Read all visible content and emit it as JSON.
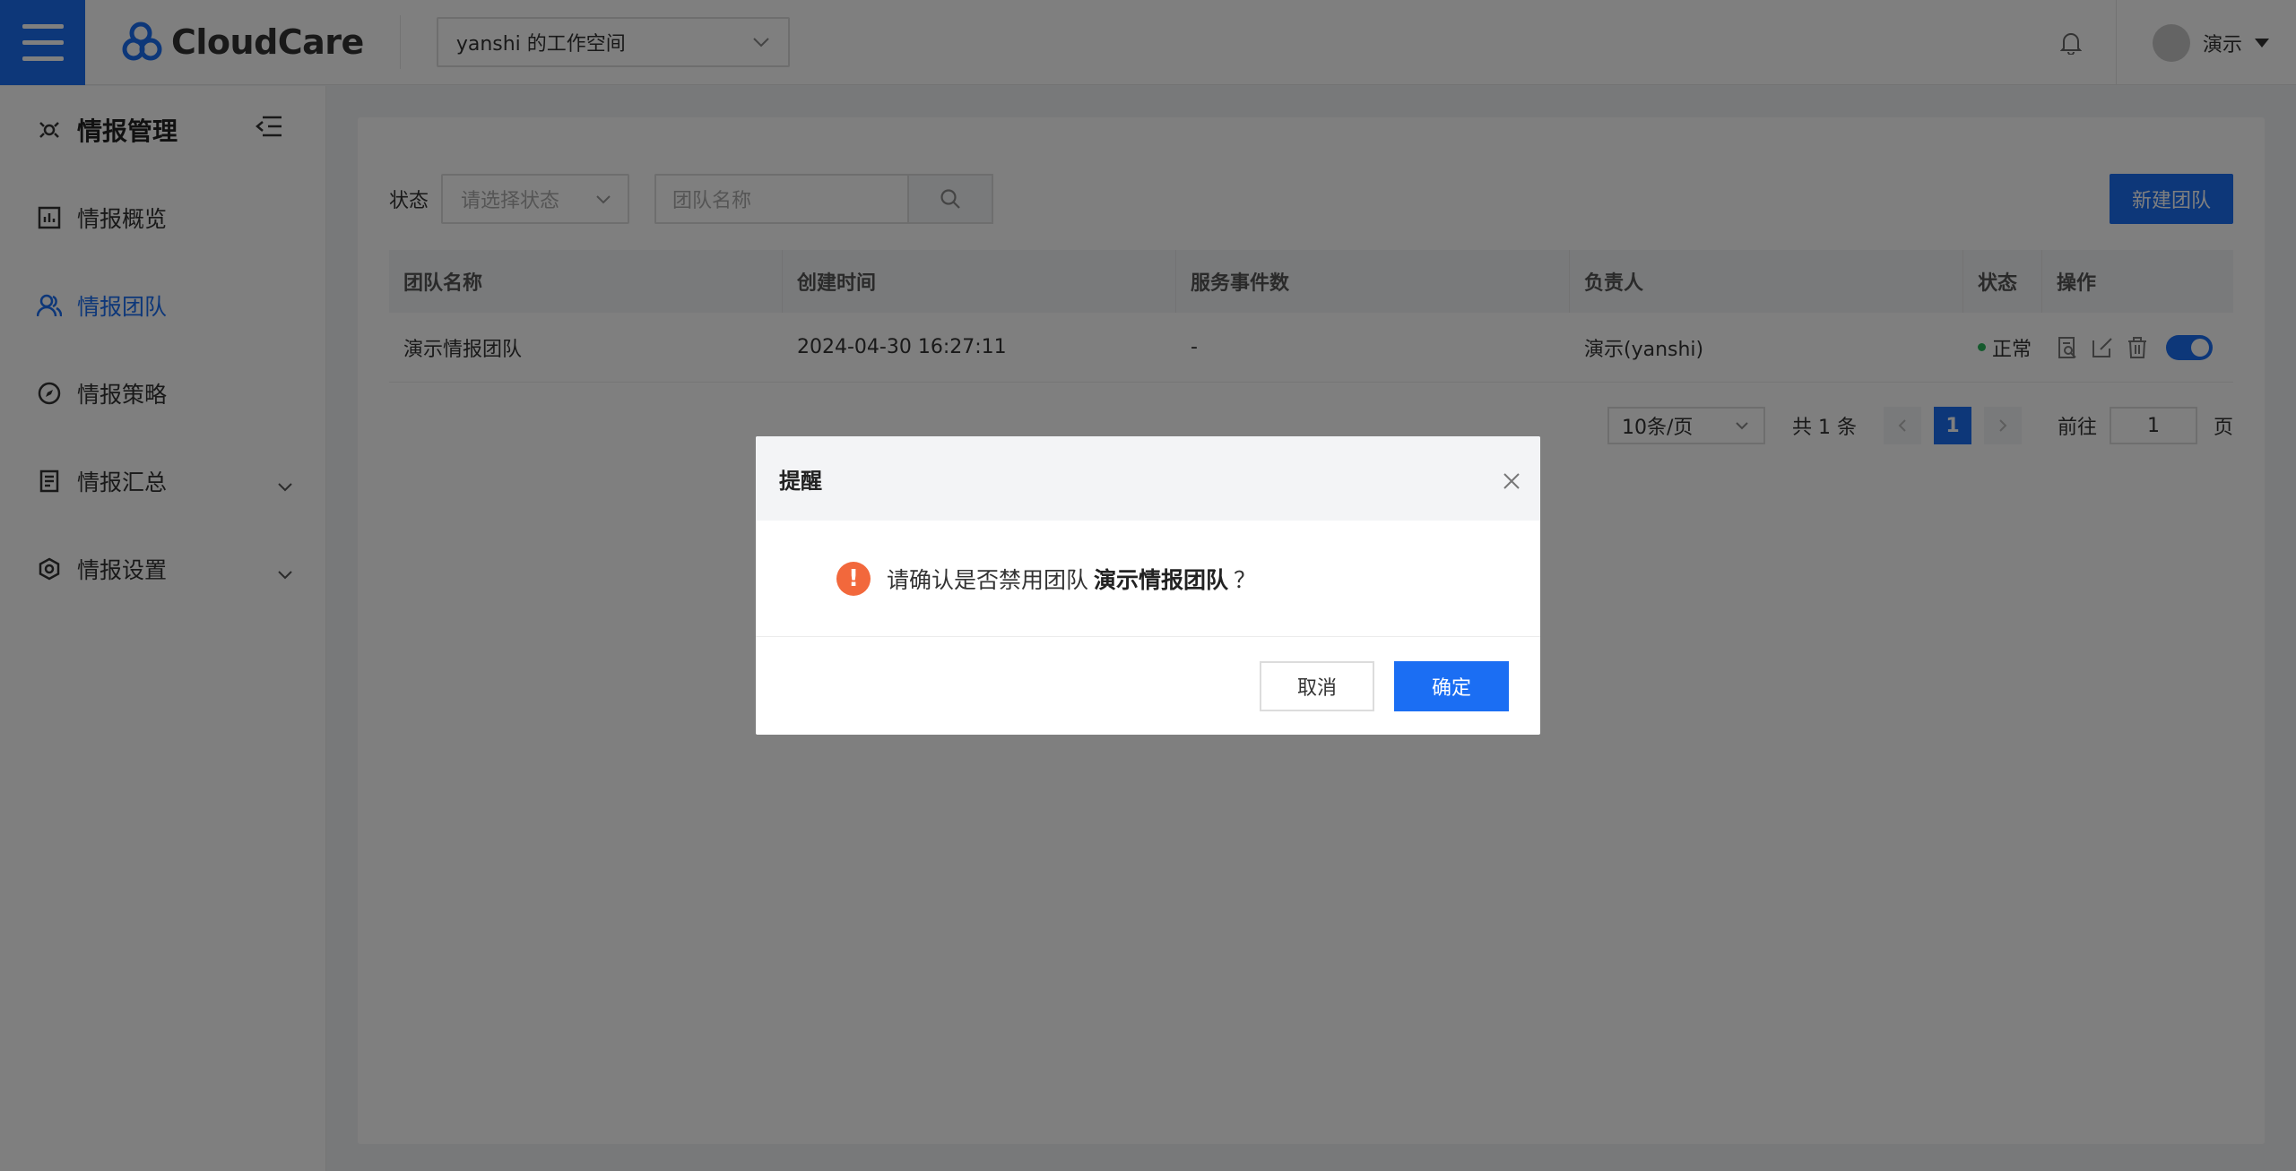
{
  "header": {
    "logo_text": "CloudCare",
    "workspace": "yanshi 的工作空间",
    "user_name": "演示"
  },
  "sidebar": {
    "title": "情报管理",
    "items": [
      {
        "label": "情报概览",
        "icon": "dashboard-icon"
      },
      {
        "label": "情报团队",
        "icon": "team-icon",
        "active": true
      },
      {
        "label": "情报策略",
        "icon": "compass-icon"
      },
      {
        "label": "情报汇总",
        "icon": "document-icon",
        "expandable": true
      },
      {
        "label": "情报设置",
        "icon": "settings-icon",
        "expandable": true
      }
    ]
  },
  "filters": {
    "status_label": "状态",
    "status_placeholder": "请选择状态",
    "name_placeholder": "团队名称",
    "new_button": "新建团队"
  },
  "table": {
    "headers": [
      "团队名称",
      "创建时间",
      "服务事件数",
      "负责人",
      "状态",
      "操作"
    ],
    "rows": [
      {
        "name": "演示情报团队",
        "created": "2024-04-30 16:27:11",
        "events": "-",
        "owner": "演示(yanshi)",
        "status": "正常"
      }
    ]
  },
  "pagination": {
    "page_size": "10条/页",
    "total": "共 1 条",
    "current_page": "1",
    "goto_label": "前往",
    "goto_value": "1",
    "page_word": "页"
  },
  "modal": {
    "title": "提醒",
    "message_prefix": "请确认是否禁用团队",
    "team_name": "演示情报团队",
    "message_suffix": "？",
    "cancel": "取消",
    "confirm": "确定"
  },
  "colors": {
    "accent": "#1b6ef3",
    "warning": "#f2683c",
    "status_ok": "#2bb45b"
  }
}
